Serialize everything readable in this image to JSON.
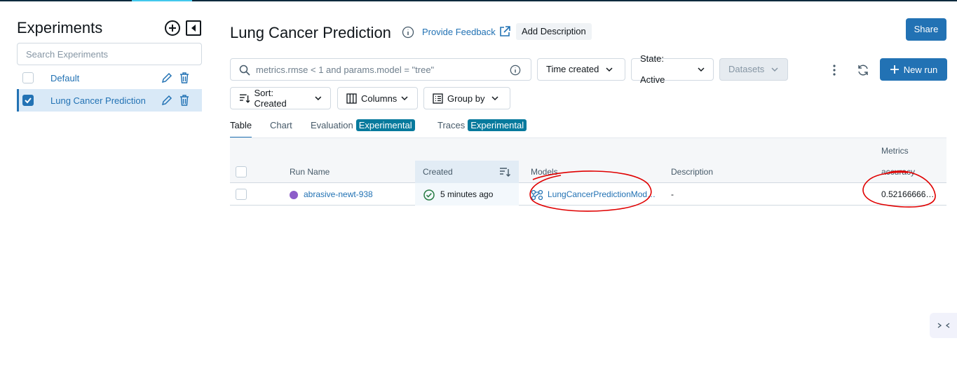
{
  "sidebar": {
    "title": "Experiments",
    "search_placeholder": "Search Experiments",
    "items": [
      {
        "label": "Default",
        "checked": false
      },
      {
        "label": "Lung Cancer Prediction",
        "checked": true
      }
    ]
  },
  "header": {
    "title": "Lung Cancer Prediction",
    "feedback": "Provide Feedback",
    "add_description": "Add Description",
    "share": "Share"
  },
  "toolbar": {
    "search_placeholder": "metrics.rmse < 1 and params.model = \"tree\"",
    "time_created": "Time created",
    "state": "State: Active",
    "datasets": "Datasets",
    "new_run": "New run",
    "sort": "Sort: Created",
    "columns": "Columns",
    "group_by": "Group by"
  },
  "tabs": [
    {
      "label": "Table"
    },
    {
      "label": "Chart"
    },
    {
      "label": "Evaluation",
      "badge": "Experimental"
    },
    {
      "label": "Traces",
      "badge": "Experimental"
    }
  ],
  "table": {
    "group_header": "Metrics",
    "columns": [
      "Run Name",
      "Created",
      "Models",
      "Description",
      "accuracy"
    ],
    "rows": [
      {
        "run_name": "abrasive-newt-938",
        "created": "5 minutes ago",
        "model": "LungCancerPredictionMod…",
        "description": "-",
        "accuracy": "0.52166666…"
      }
    ]
  },
  "colors": {
    "primary": "#2272b4",
    "annotation": "#e00000",
    "run_dot": "#8c5cc9",
    "badge": "#077a9d"
  }
}
